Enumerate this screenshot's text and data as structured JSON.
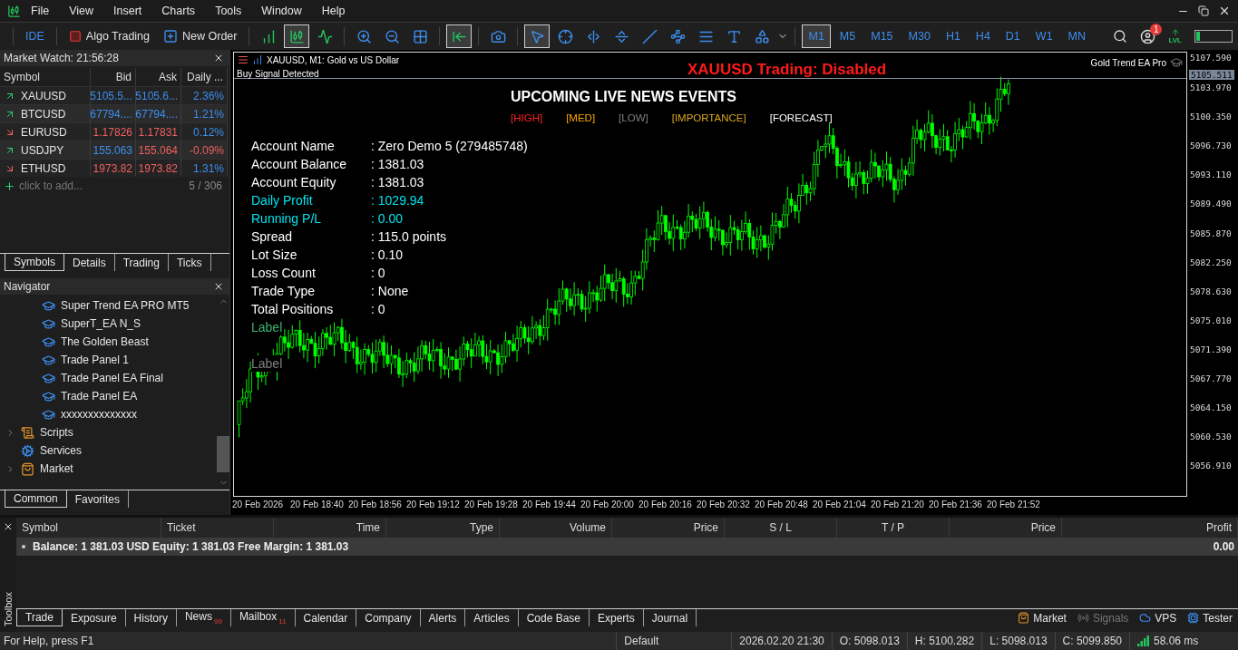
{
  "menu": [
    "File",
    "View",
    "Insert",
    "Charts",
    "Tools",
    "Window",
    "Help"
  ],
  "toolbar": {
    "buttons": [
      {
        "kind": "ide",
        "label": "IDE"
      },
      {
        "kind": "algo",
        "label": "Algo Trading"
      },
      {
        "kind": "order",
        "label": "New Order"
      }
    ],
    "tools": [
      {
        "kind": "bars",
        "selected": false
      },
      {
        "kind": "candles",
        "selected": true
      },
      {
        "kind": "line",
        "selected": false
      },
      {
        "kind": "zoom-in",
        "selected": false
      },
      {
        "kind": "zoom-out",
        "selected": false
      },
      {
        "kind": "tile",
        "selected": false
      },
      {
        "kind": "autoscroll",
        "selected": true
      },
      {
        "kind": "screenshot",
        "selected": false
      },
      {
        "kind": "cursor",
        "selected": true
      },
      {
        "kind": "crosshair",
        "selected": false
      },
      {
        "kind": "vline",
        "selected": false
      },
      {
        "kind": "hline",
        "selected": false
      },
      {
        "kind": "trend",
        "selected": false
      },
      {
        "kind": "channel",
        "selected": false
      },
      {
        "kind": "fibo",
        "selected": false
      },
      {
        "kind": "text",
        "selected": false
      },
      {
        "kind": "shapes",
        "selected": false
      }
    ],
    "timeframes": [
      {
        "label": "M1",
        "selected": true
      },
      {
        "label": "M5",
        "selected": false
      },
      {
        "label": "M15",
        "selected": false
      },
      {
        "label": "M30",
        "selected": false
      },
      {
        "label": "H1",
        "selected": false
      },
      {
        "label": "H4",
        "selected": false
      },
      {
        "label": "D1",
        "selected": false
      },
      {
        "label": "W1",
        "selected": false
      },
      {
        "label": "MN",
        "selected": false
      }
    ],
    "notification_count": "1",
    "level_label": "LVL"
  },
  "market_watch": {
    "title": "Market Watch: 21:56:28",
    "columns": [
      "Symbol",
      "Bid",
      "Ask",
      "Daily ..."
    ],
    "rows": [
      {
        "symbol": "XAUUSD",
        "rising": true,
        "bid": "5105.5...",
        "bid_up": true,
        "ask": "5105.6...",
        "ask_up": true,
        "daily": "2.36%",
        "daily_up": true
      },
      {
        "symbol": "BTCUSD",
        "rising": true,
        "bid": "67794....",
        "bid_up": true,
        "ask": "67794....",
        "ask_up": true,
        "daily": "1.21%",
        "daily_up": true
      },
      {
        "symbol": "EURUSD",
        "rising": false,
        "bid": "1.17826",
        "bid_up": false,
        "ask": "1.17831",
        "ask_up": false,
        "daily": "0.12%",
        "daily_up": true
      },
      {
        "symbol": "USDJPY",
        "rising": true,
        "bid": "155.063",
        "bid_up": true,
        "ask": "155.064",
        "ask_up": false,
        "daily": "-0.09%",
        "daily_up": false
      },
      {
        "symbol": "ETHUSD",
        "rising": false,
        "bid": "1973.82",
        "bid_up": false,
        "ask": "1973.82",
        "ask_up": false,
        "daily": "1.31%",
        "daily_up": true
      }
    ],
    "add_placeholder": "click to add...",
    "count": "5 / 306",
    "tabs": [
      {
        "label": "Symbols",
        "selected": true
      },
      {
        "label": "Details",
        "selected": false
      },
      {
        "label": "Trading",
        "selected": false
      },
      {
        "label": "Ticks",
        "selected": false
      }
    ]
  },
  "navigator": {
    "title": "Navigator",
    "experts": [
      "Super Trend EA PRO MT5",
      "SuperT_EA N_S",
      "The Golden Beast",
      "Trade Panel 1",
      "Trade Panel EA Final",
      "Trade Panel EA",
      "xxxxxxxxxxxxxx"
    ],
    "sections": [
      {
        "kind": "scripts",
        "label": "Scripts",
        "expandable": true
      },
      {
        "kind": "services",
        "label": "Services",
        "expandable": false
      },
      {
        "kind": "market",
        "label": "Market",
        "expandable": true
      }
    ],
    "tabs": [
      {
        "label": "Common",
        "selected": true
      },
      {
        "label": "Favorites",
        "selected": false
      }
    ]
  },
  "chart": {
    "title": "XAUUSD, M1:  Gold vs US Dollar",
    "signal": "Buy Signal Detected",
    "status": "XAUUSD Trading: Disabled",
    "expert": "Gold Trend EA Pro",
    "news_title": "UPCOMING LIVE NEWS EVENTS",
    "legend": [
      {
        "label": "[HIGH]",
        "color": "#ff2020"
      },
      {
        "label": "[MED]",
        "color": "#ffa500"
      },
      {
        "label": "[LOW]",
        "color": "#808080"
      },
      {
        "label": "[IMPORTANCE]",
        "color": "#daa520"
      },
      {
        "label": "[FORECAST]",
        "color": "#ffffff"
      }
    ],
    "account": [
      {
        "label": "Account Name",
        "value": ": Zero Demo 5 (279485748)",
        "color": "#ffffff"
      },
      {
        "label": "Account Balance",
        "value": ": 1381.03",
        "color": "#ffffff"
      },
      {
        "label": "Account Equity",
        "value": ": 1381.03",
        "color": "#ffffff"
      },
      {
        "label": "Daily Profit",
        "value": ": 1029.94",
        "color": "#00e5ee"
      },
      {
        "label": "Running P/L",
        "value": ": 0.00",
        "color": "#00e5ee"
      },
      {
        "label": "Spread",
        "value": ": 115.0 points",
        "color": "#ffffff"
      },
      {
        "label": "Lot Size",
        "value": ": 0.10",
        "color": "#ffffff"
      },
      {
        "label": "Loss Count",
        "value": ": 0",
        "color": "#ffffff"
      },
      {
        "label": "Trade Type",
        "value": ": None",
        "color": "#ffffff"
      },
      {
        "label": "Total Positions",
        "value": ": 0",
        "color": "#ffffff"
      }
    ],
    "labels": [
      {
        "text": "Label",
        "color": "#3cb371"
      },
      {
        "text": "Label",
        "color": "#808080"
      }
    ],
    "current_price": "5105.511",
    "price_axis": [
      "5107.590",
      "5103.970",
      "5100.350",
      "5096.730",
      "5093.110",
      "5089.490",
      "5085.870",
      "5082.250",
      "5078.630",
      "5075.010",
      "5071.390",
      "5067.770",
      "5064.150",
      "5060.530",
      "5056.910"
    ],
    "time_axis": [
      "20 Feb 2026",
      "20 Feb 18:40",
      "20 Feb 18:56",
      "20 Feb 19:12",
      "20 Feb 19:28",
      "20 Feb 19:44",
      "20 Feb 20:00",
      "20 Feb 20:16",
      "20 Feb 20:32",
      "20 Feb 20:48",
      "20 Feb 21:04",
      "20 Feb 21:20",
      "20 Feb 21:36",
      "20 Feb 21:52"
    ]
  },
  "toolbox": {
    "label": "Toolbox",
    "columns": [
      "Symbol",
      "Ticket",
      "Time",
      "Type",
      "Volume",
      "Price",
      "S / L",
      "T / P",
      "Price",
      "Profit"
    ],
    "balance": "Balance: 1 381.03 USD  Equity: 1 381.03  Free Margin: 1 381.03",
    "profit": "0.00",
    "tabs": [
      {
        "label": "Trade",
        "selected": true
      },
      {
        "label": "Exposure",
        "selected": false
      },
      {
        "label": "History",
        "selected": false
      },
      {
        "label": "News",
        "selected": false,
        "badge": "99"
      },
      {
        "label": "Mailbox",
        "selected": false,
        "badge": "11"
      },
      {
        "label": "Calendar",
        "selected": false
      },
      {
        "label": "Company",
        "selected": false
      },
      {
        "label": "Alerts",
        "selected": false
      },
      {
        "label": "Articles",
        "selected": false
      },
      {
        "label": "Code Base",
        "selected": false
      },
      {
        "label": "Experts",
        "selected": false
      },
      {
        "label": "Journal",
        "selected": false
      }
    ],
    "links": [
      {
        "kind": "market",
        "label": "Market",
        "disabled": false
      },
      {
        "kind": "signals",
        "label": "Signals",
        "disabled": true
      },
      {
        "kind": "vps",
        "label": "VPS",
        "disabled": false
      },
      {
        "kind": "tester",
        "label": "Tester",
        "disabled": false
      }
    ]
  },
  "status_bar": {
    "help": "For Help, press F1",
    "profile": "Default",
    "time": "2026.02.20 21:30",
    "open": "O: 5098.013",
    "high": "H: 5100.282",
    "low": "L: 5098.013",
    "close": "C: 5099.850",
    "ping": "58.06 ms"
  }
}
